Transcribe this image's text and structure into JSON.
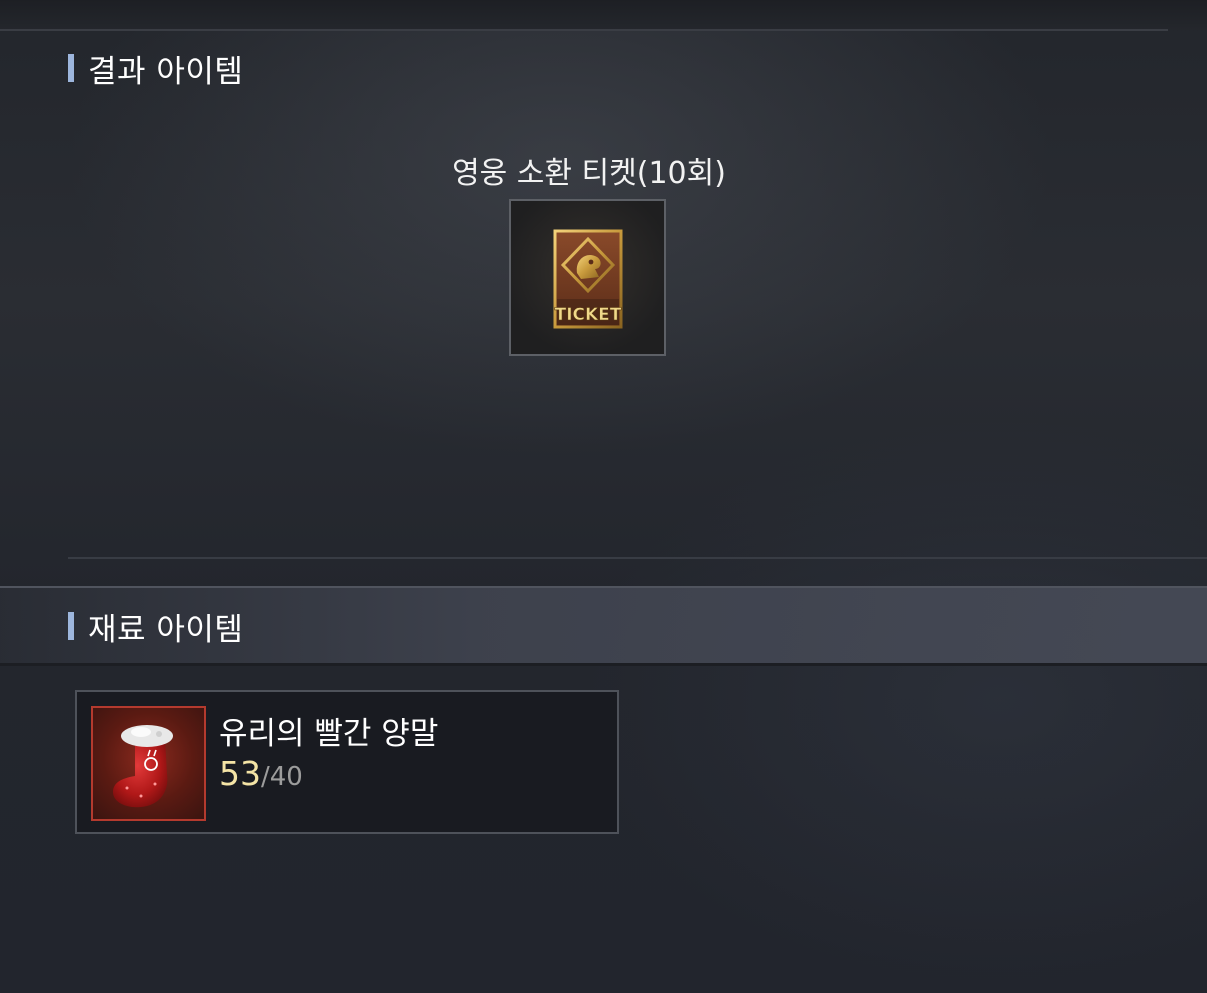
{
  "result_section": {
    "title": "결과 아이템",
    "item": {
      "name": "영웅 소환 티켓(10회)",
      "icon": "hero-summon-ticket-icon",
      "icon_text": "TICKET"
    }
  },
  "material_section": {
    "title": "재료 아이템",
    "items": [
      {
        "name": "유리의 빨간 양말",
        "icon": "red-stocking-icon",
        "have": "53",
        "separator": "/",
        "need": "40"
      }
    ]
  },
  "colors": {
    "accent_bar": "#9db6dd",
    "count_have": "#f4e4a6",
    "count_need": "#9c9c9c",
    "material_frame": "#b43a2e"
  }
}
